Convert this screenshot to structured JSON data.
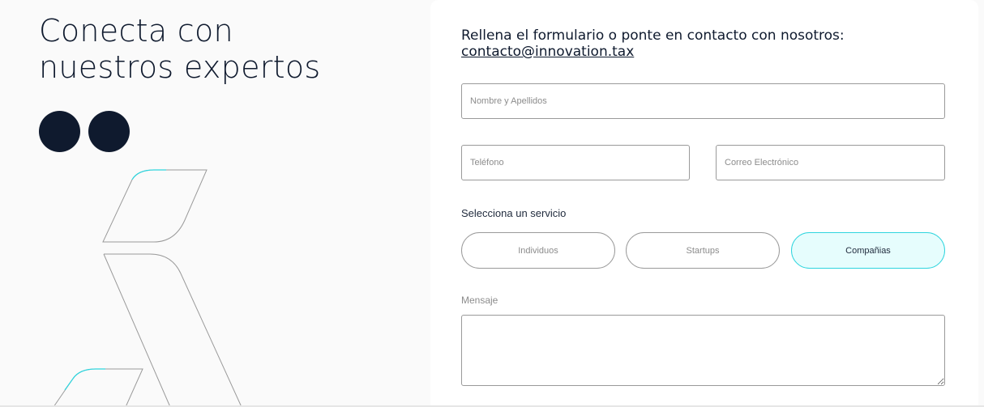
{
  "hero": {
    "headline_line1": "Conecta con",
    "headline_line2": "nuestros expertos"
  },
  "form": {
    "intro_text": "Rellena el formulario o ponte en contacto con nosotros:",
    "contact_email": "contacto@innovation.tax",
    "name_placeholder": "Nombre y Apellidos",
    "phone_placeholder": "Teléfono",
    "email_placeholder": "Correo Electrónico",
    "service_label": "Selecciona un servicio",
    "services": [
      {
        "label": "Individuos",
        "selected": false
      },
      {
        "label": "Startups",
        "selected": false
      },
      {
        "label": "Compañias",
        "selected": true
      }
    ],
    "message_label": "Mensaje",
    "message_value": ""
  },
  "colors": {
    "brand_dark": "#0f1a2e",
    "accent_cyan": "#2ed5de",
    "selected_bg": "#e6fdfd"
  }
}
